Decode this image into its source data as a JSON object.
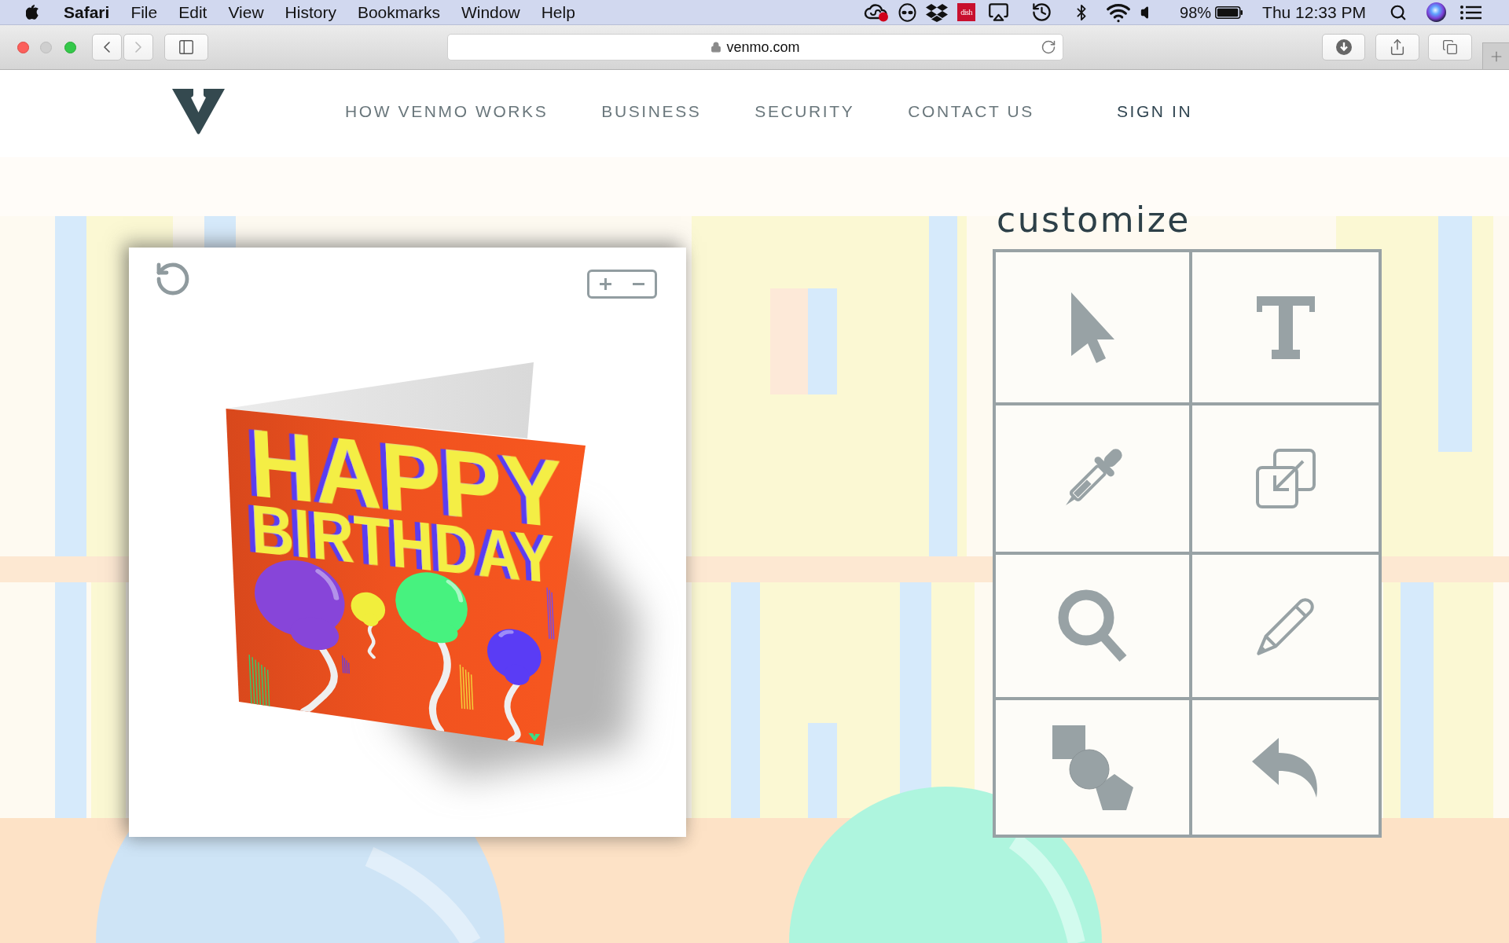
{
  "menu_bar": {
    "app": "Safari",
    "menus": [
      "File",
      "Edit",
      "View",
      "History",
      "Bookmarks",
      "Window",
      "Help"
    ],
    "badge": "dish",
    "battery": "98%",
    "clock": "Thu 12:33 PM"
  },
  "browser": {
    "address": "venmo.com",
    "back_enabled": true,
    "forward_enabled": false
  },
  "nav": {
    "links": [
      "HOW VENMO WORKS",
      "BUSINESS",
      "SECURITY",
      "CONTACT US"
    ],
    "sign_in": "SIGN IN"
  },
  "card_preview": {
    "headline": [
      "HAPPY",
      "BIRTHDAY"
    ]
  },
  "customize": {
    "title": "customize",
    "tools": [
      {
        "kind": "pointer"
      },
      {
        "kind": "text"
      },
      {
        "kind": "eyedropper"
      },
      {
        "kind": "resize"
      },
      {
        "kind": "zoom"
      },
      {
        "kind": "draw"
      },
      {
        "kind": "shapes"
      },
      {
        "kind": "undo"
      }
    ]
  }
}
